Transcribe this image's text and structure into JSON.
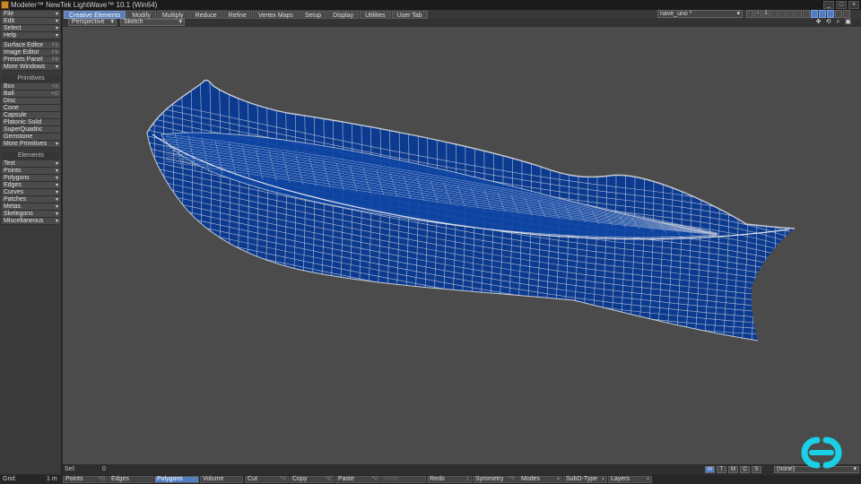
{
  "window": {
    "title": "Modeler™ NewTek LightWave™ 10.1 (Win64)",
    "controls": [
      "_",
      "□",
      "×"
    ]
  },
  "tabs": [
    {
      "label": "Creative Elements",
      "active": true
    },
    {
      "label": "Modify"
    },
    {
      "label": "Multiply"
    },
    {
      "label": "Reduce"
    },
    {
      "label": "Refine"
    },
    {
      "label": "Vertex Maps"
    },
    {
      "label": "Setup"
    },
    {
      "label": "Display"
    },
    {
      "label": "Utilities"
    },
    {
      "label": "User Tab"
    }
  ],
  "object_select": {
    "value": "nave_uno *"
  },
  "layers": [
    "1",
    "2",
    "3",
    "4",
    "5",
    "6",
    "7",
    "8",
    "9",
    "10"
  ],
  "left_toolbar": {
    "menus": [
      {
        "label": "File"
      },
      {
        "label": "Edit"
      },
      {
        "label": "Select"
      },
      {
        "label": "Help"
      }
    ],
    "editors": [
      {
        "label": "Surface Editor",
        "key": "F5"
      },
      {
        "label": "Image Editor",
        "key": "F6"
      },
      {
        "label": "Presets Panel",
        "key": "F8"
      },
      {
        "label": "More Windows"
      }
    ],
    "primitives_header": "Primitives",
    "primitives": [
      {
        "label": "Box",
        "key": "+X"
      },
      {
        "label": "Ball",
        "key": "+O"
      },
      {
        "label": "Disc"
      },
      {
        "label": "Cone"
      },
      {
        "label": "Capsule"
      },
      {
        "label": "Platonic Solid"
      },
      {
        "label": "SuperQuadric"
      },
      {
        "label": "Gemstone"
      },
      {
        "label": "More Primitives"
      }
    ],
    "elements_header": "Elements",
    "elements": [
      {
        "label": "Text"
      },
      {
        "label": "Points"
      },
      {
        "label": "Polygons"
      },
      {
        "label": "Edges"
      },
      {
        "label": "Curves"
      },
      {
        "label": "Patches"
      },
      {
        "label": "Metas"
      },
      {
        "label": "Skelegons"
      },
      {
        "label": "Miscellaneous"
      }
    ]
  },
  "viewport": {
    "view": "Perspective",
    "render_mode": "Sketch",
    "icons": [
      "move-view-icon",
      "rotate-view-icon",
      "zoom-view-icon",
      "maximize-view-icon"
    ],
    "mesh_color": "#0b3a8f",
    "wire_color": "#d4d8e0"
  },
  "status": {
    "sel_label": "Sel:",
    "sel_value": "0",
    "view_buttons": [
      "W",
      "T",
      "M",
      "C",
      "S"
    ],
    "active_view_button": "W",
    "surface_select": "(none)"
  },
  "bottombar": {
    "grid_label": "Grid:",
    "grid_value": "1 m",
    "modes": [
      {
        "label": "Points",
        "key": "^G"
      },
      {
        "label": "Edges",
        "key": ""
      },
      {
        "label": "Polygons",
        "key": "^H",
        "active": true
      },
      {
        "label": "Volume",
        "key": ""
      },
      {
        "label": "Cut",
        "key": "^X"
      },
      {
        "label": "Copy",
        "key": "^C"
      },
      {
        "label": "Paste",
        "key": "^V"
      },
      {
        "label": "Undo",
        "key": "",
        "disabled": true
      },
      {
        "label": "Redo",
        "key": "z"
      },
      {
        "label": "Symmetry",
        "key": "^Y"
      },
      {
        "label": "Modes",
        "key": ""
      },
      {
        "label": "SubD-Type",
        "key": ""
      },
      {
        "label": "Layers",
        "key": ""
      }
    ]
  },
  "colors": {
    "accent": "#4f7cc4",
    "logo": "#1ad0e6"
  }
}
